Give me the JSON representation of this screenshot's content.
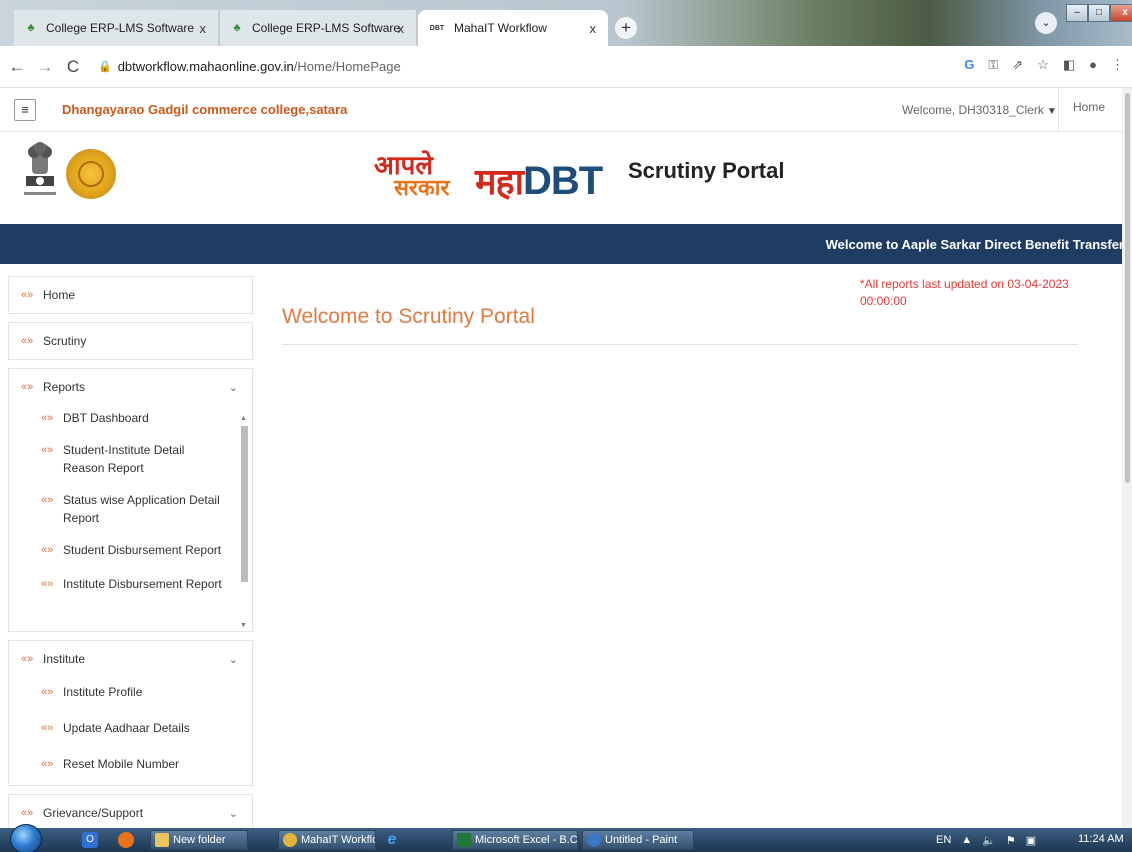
{
  "browser": {
    "tabs": [
      {
        "title": "College ERP-LMS Software",
        "close": "x"
      },
      {
        "title": "College ERP-LMS Software",
        "close": "x"
      },
      {
        "title": "MahaIT Workflow",
        "close": "x",
        "icon": "DBT"
      }
    ],
    "new_tab": "+",
    "url_domain": "dbtworkflow.mahaonline.gov.in",
    "url_path": "/Home/HomePage"
  },
  "site": {
    "college_name": "Dhangayarao Gadgil commerce college,satara",
    "welcome_user": "Welcome, DH30318_Clerk",
    "home_link": "Home",
    "logo_aaple_l1": "आपले",
    "logo_aaple_l2": "सरकार",
    "logo_maha": "महा",
    "logo_dbt": "DBT",
    "portal_title": "Scrutiny Portal",
    "banner_text": "Welcome to Aaple Sarkar Direct Benefit Transfer"
  },
  "sidebar": {
    "home": "Home",
    "scrutiny": "Scrutiny",
    "reports": {
      "label": "Reports",
      "items": [
        "DBT Dashboard",
        "Student-Institute Detail Reason Report",
        "Status wise Application Detail Report",
        "Student Disbursement Report",
        "Institute Disbursement Report"
      ]
    },
    "institute": {
      "label": "Institute",
      "items": [
        "Institute Profile",
        "Update Aadhaar Details",
        "Reset Mobile Number"
      ]
    },
    "grievance": "Grievance/Support"
  },
  "main": {
    "update_note": "*All reports last updated on 03-04-2023 00:00:00",
    "title": "Welcome to Scrutiny Portal"
  },
  "taskbar": {
    "buttons": [
      "New folder",
      "MahaIT Workflow - ...",
      "Microsoft Excel - B.C...",
      "Untitled - Paint"
    ],
    "lang": "EN",
    "clock": "11:24 AM"
  }
}
